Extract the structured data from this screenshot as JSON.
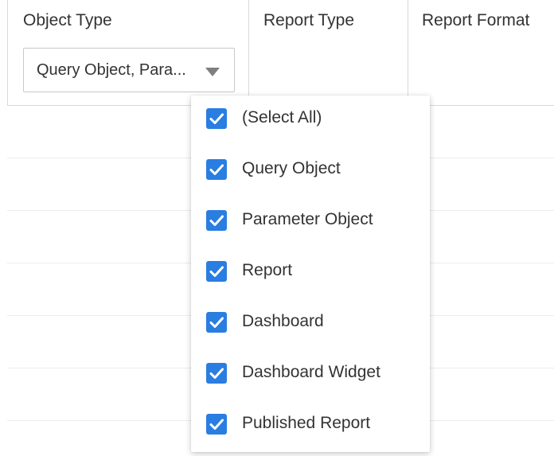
{
  "columns": {
    "object_type": "Object Type",
    "report_type": "Report Type",
    "report_format": "Report Format"
  },
  "filter": {
    "value": "Query Object, Para...",
    "caret_icon": "caret-down-icon"
  },
  "dropdown": {
    "accent": "#2a7de1",
    "check_icon": "checkmark-icon",
    "options": [
      {
        "label": "(Select All)",
        "checked": true
      },
      {
        "label": "Query Object",
        "checked": true
      },
      {
        "label": "Parameter Object",
        "checked": true
      },
      {
        "label": "Report",
        "checked": true
      },
      {
        "label": "Dashboard",
        "checked": true
      },
      {
        "label": "Dashboard Widget",
        "checked": true
      },
      {
        "label": "Published Report",
        "checked": true
      }
    ]
  }
}
